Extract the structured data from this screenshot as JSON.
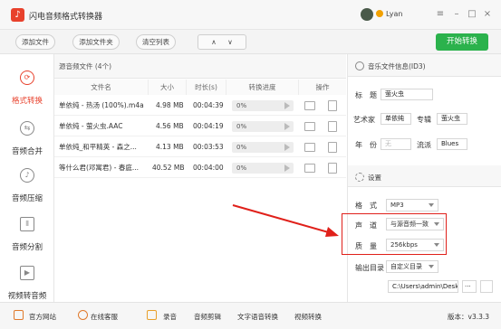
{
  "window": {
    "title": "闪电音频格式转换器",
    "user_name": "Lyan",
    "controls": [
      "≡",
      "–",
      "□",
      "×"
    ]
  },
  "toolbar": {
    "add_file": "添加文件",
    "add_folder": "添加文件夹",
    "clear_list": "清空列表",
    "move_up": "∧",
    "move_down": "∨",
    "start_convert": "开始转换",
    "accent_color": "#2bb24c"
  },
  "sidebar": {
    "items": [
      {
        "label": "格式转换",
        "icon": "refresh-icon",
        "active": true
      },
      {
        "label": "音频合并",
        "icon": "merge-icon",
        "active": false
      },
      {
        "label": "音频压缩",
        "icon": "compress-icon",
        "active": false
      },
      {
        "label": "音频分割",
        "icon": "split-icon",
        "active": false
      },
      {
        "label": "视频转音频",
        "icon": "video-icon",
        "active": false
      }
    ],
    "active_color": "#e8412c"
  },
  "file_list": {
    "title": "源音频文件 (4个)",
    "columns": [
      "文件名",
      "大小",
      "时长(s)",
      "转换进度",
      "操作"
    ],
    "rows": [
      {
        "name": "单依纯 - 热汤 (100%).m4a",
        "size": "4.98 MB",
        "duration": "00:04:39",
        "progress": "0%"
      },
      {
        "name": "单依纯 - 萤火虫.AAC",
        "size": "4.56 MB",
        "duration": "00:04:19",
        "progress": "0%"
      },
      {
        "name": "单依纯_和平精英 - 森之...",
        "size": "4.13 MB",
        "duration": "00:03:53",
        "progress": "0%"
      },
      {
        "name": "等什么君(邓寓君) - 春庭...",
        "size": "40.52 MB",
        "duration": "00:04:00",
        "progress": "0%"
      }
    ]
  },
  "id3": {
    "header": "音乐文件信息(ID3)",
    "title_label": "标　题",
    "title_value": "萤火虫",
    "artist_label": "艺术家",
    "artist_value": "单依纯",
    "album_label": "专辑",
    "album_value": "萤火虫",
    "year_label": "年　份",
    "year_value": "无",
    "genre_label": "流派",
    "genre_value": "Blues"
  },
  "settings": {
    "header": "设置",
    "format_label": "格　式",
    "format_value": "MP3",
    "channel_label": "声　道",
    "channel_value": "与源音频一致",
    "quality_label": "质　量",
    "quality_value": "256kbps",
    "output_label": "输出目录",
    "output_value": "自定义目录",
    "path_value": "C:\\Users\\admin\\Desktc",
    "browse_label": "···"
  },
  "statusbar": {
    "website": "官方网站",
    "support": "在线客服",
    "record": "录音",
    "audio_edit": "音频剪辑",
    "tts": "文字语音转换",
    "video_convert": "视频转换",
    "version": "版本：v3.3.3"
  }
}
